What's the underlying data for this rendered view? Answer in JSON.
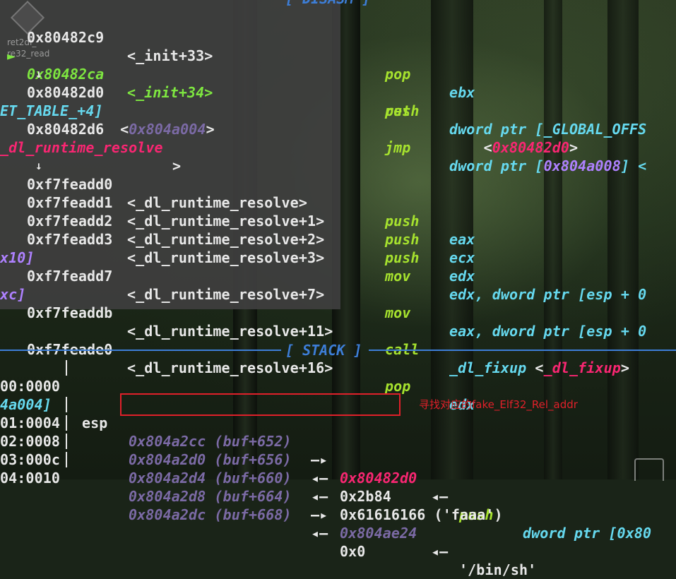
{
  "disasm_header": "[ DISASM ]",
  "stack_header": "[ STACK ]",
  "desktop_icon_label": "ret2dl_\nre32_read",
  "annotation": "寻找对应的fake_Elf32_Rel_addr",
  "disasm": {
    "l1_addr": "0x80482c9",
    "l1_sym": "<_init+33>",
    "l1_mn": "pop",
    "l1_op": "ebx",
    "l2_marker": "►",
    "l2_addr": "0x80482ca",
    "l2_sym": "<_init+34>",
    "l2_mn": "ret",
    "l2_op_a": "<",
    "l2_op_b": "0x80482d0",
    "l2_op_c": ">",
    "down1": "↓",
    "l3_addr": "0x80482d0",
    "l3_mn": "push",
    "l3_op": "dword ptr [_GLOBAL_OFFS",
    "l3b_a": "ET_TABLE_+4]",
    "l3b_b": " <",
    "l3b_c": "0x804a004",
    "l3b_d": ">",
    "l4_addr": "0x80482d6",
    "l4_mn": "jmp",
    "l4_op_a": "dword ptr [",
    "l4_op_b": "0x804a008",
    "l4_op_c": "] <",
    "l4b_a": "_dl_runtime_resolve",
    "l4b_b": ">",
    "down2": "↓",
    "l5_addr": "0xf7feadd0",
    "l5_sym": "<_dl_runtime_resolve>",
    "l5_mn": "push",
    "l5_op": "eax",
    "l6_addr": "0xf7feadd1",
    "l6_sym": "<_dl_runtime_resolve+1>",
    "l6_mn": "push",
    "l6_op": "ecx",
    "l7_addr": "0xf7feadd2",
    "l7_sym": "<_dl_runtime_resolve+2>",
    "l7_mn": "push",
    "l7_op": "edx",
    "l8_addr": "0xf7feadd3",
    "l8_sym": "<_dl_runtime_resolve+3>",
    "l8_mn": "mov",
    "l8_op": "edx, dword ptr [esp + 0",
    "l8b": "x10]",
    "l9_addr": "0xf7feadd7",
    "l9_sym": "<_dl_runtime_resolve+7>",
    "l9_mn": "mov",
    "l9_op": "eax, dword ptr [esp + 0",
    "l9b": "xc]",
    "l10_addr": "0xf7feaddb",
    "l10_sym": "<_dl_runtime_resolve+11>",
    "l10_mn": "call",
    "l10_op_a": "_dl_fixup",
    "l10_op_b": " <",
    "l10_op_c": "_dl_fixup",
    "l10_op_d": ">",
    "l11_addr": "0xf7feade0",
    "l11_sym": "<_dl_runtime_resolve+16>",
    "l11_mn": "pop",
    "l11_op": "edx"
  },
  "stack": {
    "s0_off": "00:0000",
    "s0_reg": "esp",
    "s0_addr": "0x804a2cc (buf+652)",
    "s0_arrow": "—▸",
    "s0_val": "0x80482d0",
    "s0_arrow2": "◂—",
    "s0_ins": "push",
    "s0_op": "dword ptr [0x80",
    "s0b": "4a004]",
    "s1_off": "01:0004",
    "s1_addr": "0x804a2d0 (buf+656)",
    "s1_arrow": "◂—",
    "s1_val": "0x2b84",
    "s2_off": "02:0008",
    "s2_addr": "0x804a2d4 (buf+660)",
    "s2_arrow": "◂—",
    "s2_val": "0x61616166 ('faaa')",
    "s3_off": "03:000c",
    "s3_addr": "0x804a2d8 (buf+664)",
    "s3_arrow": "—▸",
    "s3_val": "0x804ae24",
    "s3_arrow2": "◂—",
    "s3_str": "'/bin/sh'",
    "s4_off": "04:0010",
    "s4_addr": "0x804a2dc (buf+668)",
    "s4_arrow": "◂—",
    "s4_val": "0x0"
  },
  "colors": {
    "address": "#e8e8e8",
    "mnemonic": "#a6e22e",
    "operand": "#66d9ef",
    "pointer": "#ae81ff",
    "symbol_red": "#f92672",
    "header": "#3d7ed8",
    "annotation": "#e0202a"
  },
  "icons": [
    "desktop-file-icon",
    "trash-icon"
  ]
}
